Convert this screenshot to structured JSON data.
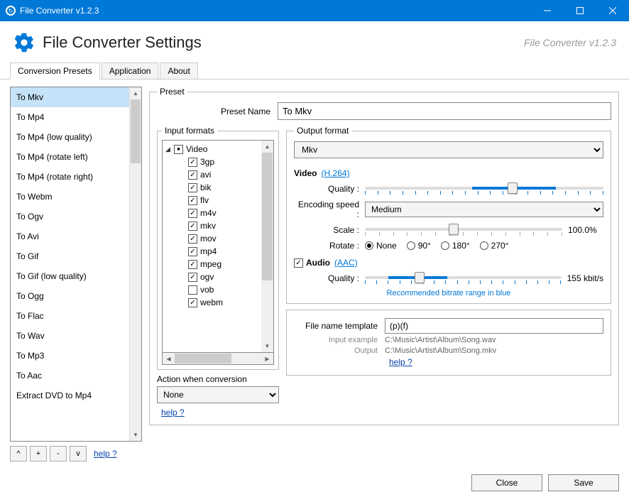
{
  "window": {
    "title": "File Converter v1.2.3"
  },
  "header": {
    "title": "File Converter Settings",
    "version": "File Converter v1.2.3"
  },
  "tabs": {
    "conversion": "Conversion Presets",
    "application": "Application",
    "about": "About"
  },
  "presets": {
    "items": [
      "To Mkv",
      "To Mp4",
      "To Mp4 (low quality)",
      "To Mp4 (rotate left)",
      "To Mp4 (rotate right)",
      "To Webm",
      "To Ogv",
      "To Avi",
      "To Gif",
      "To Gif (low quality)",
      "To Ogg",
      "To Flac",
      "To Wav",
      "To Mp3",
      "To Aac",
      "Extract DVD to Mp4"
    ],
    "selected_index": 0,
    "btn_up": "^",
    "btn_add": "+",
    "btn_remove": "-",
    "btn_down": "v",
    "help": "help ?"
  },
  "preset_group": {
    "legend": "Preset",
    "name_label": "Preset Name",
    "name_value": "To Mkv"
  },
  "input_formats": {
    "legend": "Input formats",
    "root": "Video",
    "items": [
      {
        "name": "3gp",
        "checked": true
      },
      {
        "name": "avi",
        "checked": true
      },
      {
        "name": "bik",
        "checked": true
      },
      {
        "name": "flv",
        "checked": true
      },
      {
        "name": "m4v",
        "checked": true
      },
      {
        "name": "mkv",
        "checked": true
      },
      {
        "name": "mov",
        "checked": true
      },
      {
        "name": "mp4",
        "checked": true
      },
      {
        "name": "mpeg",
        "checked": true
      },
      {
        "name": "ogv",
        "checked": true
      },
      {
        "name": "vob",
        "checked": false
      },
      {
        "name": "webm",
        "checked": true
      }
    ],
    "action_label": "Action when conversion",
    "action_value": "None",
    "help": "help ?"
  },
  "output": {
    "legend": "Output format",
    "format": "Mkv",
    "video": {
      "title": "Video",
      "codec": "(H.264)",
      "quality_label": "Quality :",
      "encoding_label": "Encoding speed :",
      "encoding_value": "Medium",
      "scale_label": "Scale :",
      "scale_value": "100.0%",
      "rotate_label": "Rotate :",
      "rotate_options": [
        "None",
        "90°",
        "180°",
        "270°"
      ],
      "rotate_selected": 0
    },
    "audio": {
      "title": "Audio",
      "codec": "(AAC)",
      "checked": true,
      "quality_label": "Quality :",
      "quality_value": "155 kbit/s",
      "recommended": "Recommended bitrate range in blue"
    }
  },
  "fname": {
    "template_label": "File name template",
    "template_value": "(p)(f)",
    "input_example_label": "Input example",
    "input_example_value": "C:\\Music\\Artist\\Album\\Song.wav",
    "output_label": "Output",
    "output_value": "C:\\Music\\Artist\\Album\\Song.mkv",
    "help": "help ?"
  },
  "footer": {
    "close": "Close",
    "save": "Save"
  }
}
